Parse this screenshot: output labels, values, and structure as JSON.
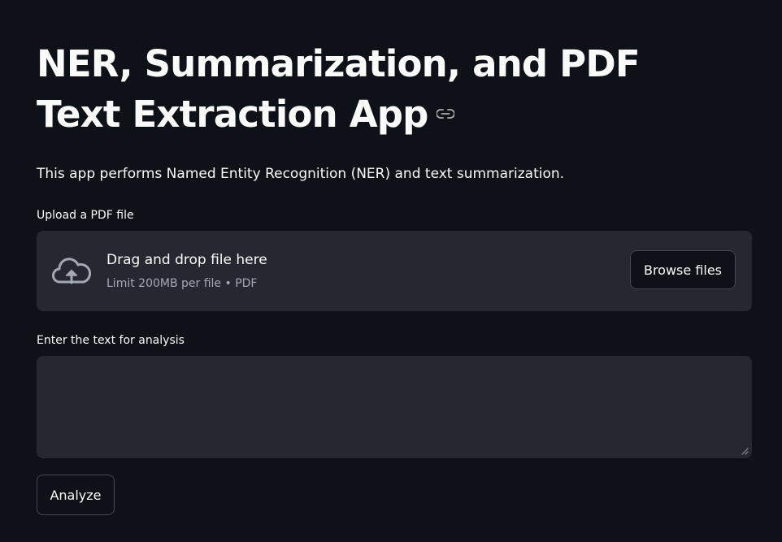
{
  "page": {
    "title": "NER, Summarization, and PDF Text Extraction App",
    "description": "This app performs Named Entity Recognition (NER) and text summarization."
  },
  "uploader": {
    "label": "Upload a PDF file",
    "drop_title": "Drag and drop file here",
    "drop_subtitle": "Limit 200MB per file • PDF",
    "browse_label": "Browse files",
    "icon": "cloud-upload-icon"
  },
  "text_input": {
    "label": "Enter the text for analysis",
    "value": "",
    "placeholder": ""
  },
  "actions": {
    "analyze_label": "Analyze"
  },
  "colors": {
    "background": "#0e1117",
    "surface": "#262730",
    "text": "#fafafa",
    "muted_text": "#a3a8b4",
    "border": "#464955"
  }
}
